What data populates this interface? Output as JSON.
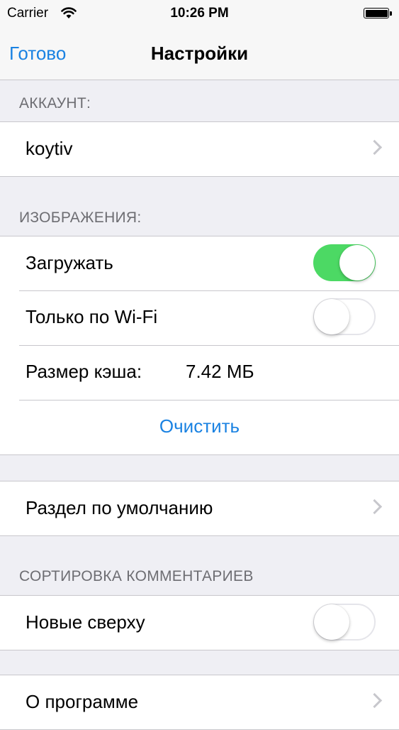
{
  "status_bar": {
    "carrier": "Carrier",
    "time": "10:26 PM",
    "battery_level": 1.0
  },
  "nav": {
    "done_label": "Готово",
    "title": "Настройки"
  },
  "sections": {
    "account": {
      "header": "АККАУНТ:",
      "username": "koytiv"
    },
    "images": {
      "header": "ИЗОБРАЖЕНИЯ:",
      "download_label": "Загружать",
      "download_on": true,
      "wifi_only_label": "Только по Wi-Fi",
      "wifi_only_on": false,
      "cache_label": "Размер кэша:",
      "cache_value": "7.42 МБ",
      "clear_label": "Очистить"
    },
    "default_section": {
      "label": "Раздел по умолчанию"
    },
    "comments_sort": {
      "header": "СОРТИРОВКА КОММЕНТАРИЕВ",
      "newest_first_label": "Новые сверху",
      "newest_first_on": false
    },
    "about": {
      "label": "О программе"
    }
  },
  "colors": {
    "accent": "#1a82e2",
    "toggle_on": "#4cd964",
    "background": "#efeff4",
    "header_text": "#6d6d72",
    "separator": "#c8c7cc"
  },
  "icons": {
    "wifi": "wifi-icon",
    "battery": "battery-icon",
    "chevron": "chevron-right-icon"
  }
}
